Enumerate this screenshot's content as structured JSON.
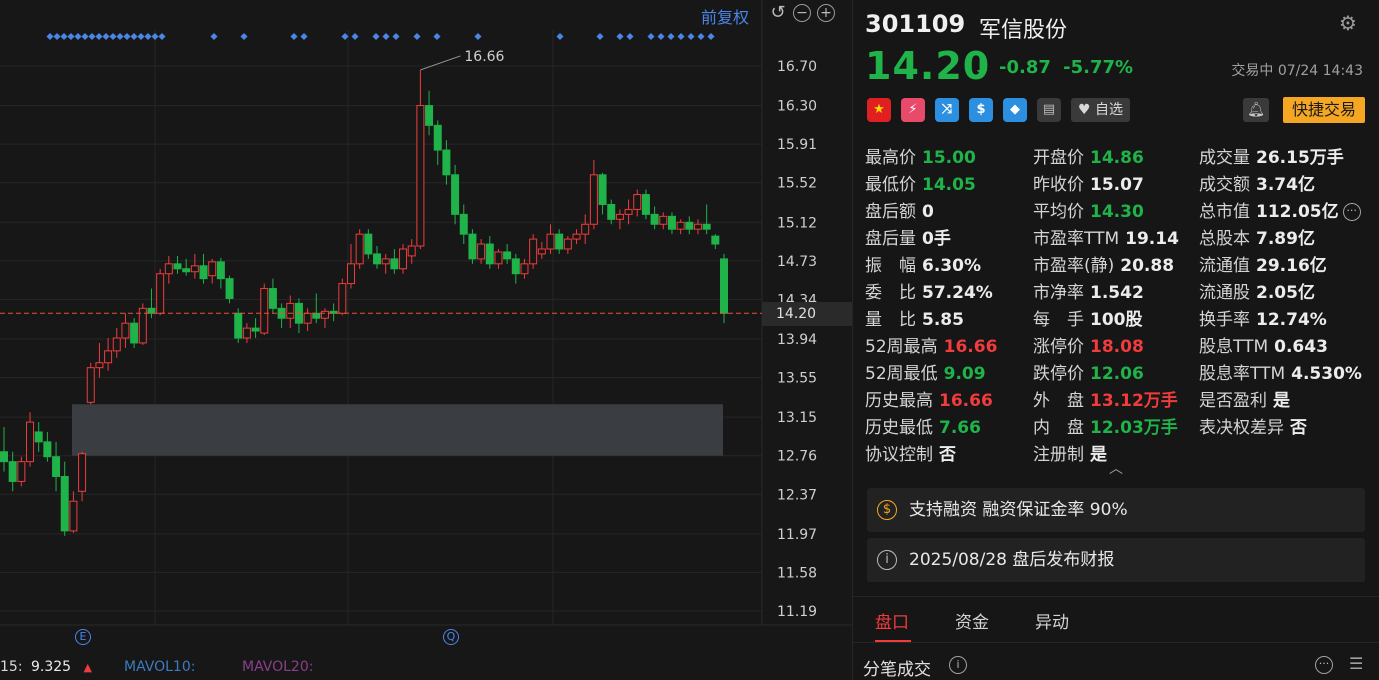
{
  "chart": {
    "adjust_label": "前复权",
    "undo_icon": "undo-icon",
    "minus_icon": "zoom-out-icon",
    "plus_icon": "zoom-in-icon",
    "high_label": "16.66",
    "price_tag": "14.20",
    "event_e": "E",
    "event_q": "Q",
    "mavol": {
      "ma5_label": "15:",
      "ma5_value": "9.325",
      "ma10_label": "MAVOL10:",
      "ma20_label": "MAVOL20:"
    },
    "colors": {
      "up": "#f03c3c",
      "down": "#1fb34a",
      "mavol10": "#3b7bbf",
      "mavol20": "#8a3f8a",
      "accent": "#4a86e8",
      "last_price_line": "#e8552e"
    }
  },
  "chart_data": {
    "type": "candlestick",
    "y_ticks": [
      "16.70",
      "16.30",
      "15.91",
      "15.52",
      "15.12",
      "14.73",
      "14.34",
      "13.94",
      "13.55",
      "13.15",
      "12.76",
      "12.37",
      "11.97",
      "11.58",
      "11.19"
    ],
    "ylim": [
      11.19,
      16.7
    ],
    "last_price": 14.2,
    "period_high": 16.66,
    "gap_zone": [
      12.76,
      13.28
    ],
    "candles": [
      [
        12.8,
        13.05,
        12.6,
        12.7
      ],
      [
        12.7,
        12.8,
        12.4,
        12.5
      ],
      [
        12.5,
        12.75,
        12.45,
        12.7
      ],
      [
        12.7,
        13.2,
        12.65,
        13.1
      ],
      [
        13.0,
        13.1,
        12.8,
        12.9
      ],
      [
        12.9,
        13.0,
        12.7,
        12.75
      ],
      [
        12.75,
        12.9,
        12.4,
        12.55
      ],
      [
        12.55,
        12.7,
        11.95,
        12.0
      ],
      [
        12.0,
        12.4,
        11.98,
        12.3
      ],
      [
        12.4,
        12.8,
        12.3,
        12.78
      ],
      [
        13.3,
        13.7,
        13.28,
        13.65
      ],
      [
        13.65,
        13.9,
        13.55,
        13.7
      ],
      [
        13.7,
        13.95,
        13.62,
        13.82
      ],
      [
        13.82,
        14.05,
        13.75,
        13.95
      ],
      [
        13.95,
        14.2,
        13.85,
        14.1
      ],
      [
        14.1,
        14.15,
        13.85,
        13.9
      ],
      [
        13.9,
        14.3,
        13.88,
        14.25
      ],
      [
        14.25,
        14.45,
        14.15,
        14.2
      ],
      [
        14.2,
        14.65,
        14.18,
        14.6
      ],
      [
        14.6,
        14.78,
        14.5,
        14.7
      ],
      [
        14.7,
        14.78,
        14.6,
        14.65
      ],
      [
        14.65,
        14.75,
        14.58,
        14.62
      ],
      [
        14.62,
        14.8,
        14.55,
        14.68
      ],
      [
        14.68,
        14.8,
        14.5,
        14.55
      ],
      [
        14.58,
        14.75,
        14.5,
        14.72
      ],
      [
        14.72,
        14.76,
        14.45,
        14.55
      ],
      [
        14.55,
        14.58,
        14.3,
        14.35
      ],
      [
        14.2,
        14.25,
        13.9,
        13.95
      ],
      [
        13.95,
        14.1,
        13.9,
        14.05
      ],
      [
        14.05,
        14.15,
        13.95,
        14.02
      ],
      [
        14.0,
        14.5,
        13.98,
        14.45
      ],
      [
        14.45,
        14.55,
        14.2,
        14.25
      ],
      [
        14.25,
        14.3,
        14.05,
        14.15
      ],
      [
        14.15,
        14.38,
        14.05,
        14.3
      ],
      [
        14.3,
        14.35,
        14.0,
        14.1
      ],
      [
        14.1,
        14.25,
        14.02,
        14.2
      ],
      [
        14.2,
        14.4,
        14.1,
        14.15
      ],
      [
        14.15,
        14.25,
        14.05,
        14.22
      ],
      [
        14.22,
        14.3,
        14.12,
        14.2
      ],
      [
        14.2,
        14.55,
        14.18,
        14.5
      ],
      [
        14.5,
        14.9,
        14.45,
        14.7
      ],
      [
        14.7,
        15.05,
        14.65,
        15.0
      ],
      [
        15.0,
        15.05,
        14.75,
        14.8
      ],
      [
        14.8,
        14.88,
        14.65,
        14.7
      ],
      [
        14.7,
        14.8,
        14.6,
        14.75
      ],
      [
        14.75,
        14.85,
        14.6,
        14.65
      ],
      [
        14.65,
        14.9,
        14.6,
        14.85
      ],
      [
        14.78,
        14.95,
        14.7,
        14.88
      ],
      [
        14.88,
        16.66,
        14.85,
        16.3
      ],
      [
        16.3,
        16.45,
        16.0,
        16.1
      ],
      [
        16.1,
        16.15,
        15.7,
        15.85
      ],
      [
        15.85,
        15.95,
        15.5,
        15.6
      ],
      [
        15.6,
        15.7,
        15.1,
        15.2
      ],
      [
        15.2,
        15.3,
        14.9,
        15.0
      ],
      [
        15.0,
        15.05,
        14.7,
        14.75
      ],
      [
        14.75,
        14.95,
        14.7,
        14.9
      ],
      [
        14.9,
        14.98,
        14.65,
        14.7
      ],
      [
        14.7,
        14.85,
        14.65,
        14.82
      ],
      [
        14.82,
        14.9,
        14.7,
        14.75
      ],
      [
        14.75,
        14.8,
        14.5,
        14.6
      ],
      [
        14.6,
        14.75,
        14.55,
        14.7
      ],
      [
        14.7,
        15.0,
        14.65,
        14.95
      ],
      [
        14.8,
        14.92,
        14.75,
        14.85
      ],
      [
        14.85,
        15.1,
        14.8,
        15.0
      ],
      [
        15.0,
        15.05,
        14.8,
        14.85
      ],
      [
        14.85,
        14.98,
        14.8,
        14.95
      ],
      [
        14.95,
        15.05,
        14.9,
        15.0
      ],
      [
        15.0,
        15.2,
        14.9,
        15.1
      ],
      [
        15.1,
        15.75,
        15.05,
        15.6
      ],
      [
        15.6,
        15.62,
        15.2,
        15.3
      ],
      [
        15.3,
        15.35,
        15.1,
        15.15
      ],
      [
        15.15,
        15.25,
        15.05,
        15.2
      ],
      [
        15.2,
        15.35,
        15.1,
        15.25
      ],
      [
        15.25,
        15.45,
        15.18,
        15.4
      ],
      [
        15.4,
        15.45,
        15.15,
        15.2
      ],
      [
        15.2,
        15.28,
        15.05,
        15.1
      ],
      [
        15.1,
        15.22,
        15.05,
        15.18
      ],
      [
        15.18,
        15.22,
        15.0,
        15.05
      ],
      [
        15.05,
        15.15,
        15.0,
        15.12
      ],
      [
        15.12,
        15.18,
        15.0,
        15.05
      ],
      [
        15.05,
        15.15,
        15.0,
        15.1
      ],
      [
        15.1,
        15.3,
        15.0,
        15.05
      ],
      [
        14.98,
        15.0,
        14.85,
        14.9
      ],
      [
        14.75,
        14.8,
        14.1,
        14.2
      ]
    ]
  },
  "quote": {
    "code": "301109",
    "name": "军信股份",
    "price": "14.20",
    "change": "-0.87",
    "change_pct": "-5.77%",
    "status": "交易中 07/24 14:43",
    "fav_label": "自选",
    "quick_trade": "快捷交易"
  },
  "stats": {
    "col1": [
      {
        "k": "最高价",
        "v": "15.00",
        "c": "g"
      },
      {
        "k": "最低价",
        "v": "14.05",
        "c": "g"
      },
      {
        "k": "盘后额",
        "v": "0",
        "c": "w"
      },
      {
        "k": "盘后量",
        "v": "0手",
        "c": "w"
      },
      {
        "k": "振　幅",
        "v": "6.30%",
        "c": "w"
      },
      {
        "k": "委　比",
        "v": "57.24%",
        "c": "w"
      },
      {
        "k": "量　比",
        "v": "5.85",
        "c": "w"
      },
      {
        "k": "52周最高",
        "v": "16.66",
        "c": "r"
      },
      {
        "k": "52周最低",
        "v": "9.09",
        "c": "g"
      },
      {
        "k": "历史最高",
        "v": "16.66",
        "c": "r"
      },
      {
        "k": "历史最低",
        "v": "7.66",
        "c": "g"
      },
      {
        "k": "协议控制",
        "v": "否",
        "c": "w"
      }
    ],
    "col2": [
      {
        "k": "开盘价",
        "v": "14.86",
        "c": "g"
      },
      {
        "k": "昨收价",
        "v": "15.07",
        "c": "w"
      },
      {
        "k": "平均价",
        "v": "14.30",
        "c": "g"
      },
      {
        "k": "市盈率TTM",
        "v": "19.14",
        "c": "w"
      },
      {
        "k": "市盈率(静)",
        "v": "20.88",
        "c": "w"
      },
      {
        "k": "市净率",
        "v": "1.542",
        "c": "w"
      },
      {
        "k": "每　手",
        "v": "100股",
        "c": "w"
      },
      {
        "k": "涨停价",
        "v": "18.08",
        "c": "r"
      },
      {
        "k": "跌停价",
        "v": "12.06",
        "c": "g"
      },
      {
        "k": "外　盘",
        "v": "13.12万手",
        "c": "r"
      },
      {
        "k": "内　盘",
        "v": "12.03万手",
        "c": "g"
      },
      {
        "k": "注册制",
        "v": "是",
        "c": "w"
      }
    ],
    "col3": [
      {
        "k": "成交量",
        "v": "26.15万手",
        "c": "w"
      },
      {
        "k": "成交额",
        "v": "3.74亿",
        "c": "w"
      },
      {
        "k": "总市值",
        "v": "112.05亿",
        "c": "w"
      },
      {
        "k": "总股本",
        "v": "7.89亿",
        "c": "w"
      },
      {
        "k": "流通值",
        "v": "29.16亿",
        "c": "w"
      },
      {
        "k": "流通股",
        "v": "2.05亿",
        "c": "w"
      },
      {
        "k": "换手率",
        "v": "12.74%",
        "c": "w"
      },
      {
        "k": "股息TTM",
        "v": "0.643",
        "c": "w"
      },
      {
        "k": "股息率TTM",
        "v": "4.530%",
        "c": "w"
      },
      {
        "k": "是否盈利",
        "v": "是",
        "c": "w"
      },
      {
        "k": "表决权差异",
        "v": "否",
        "c": "w"
      }
    ]
  },
  "notices": {
    "margin": "支持融资 融资保证金率 90%",
    "report": "2025/08/28  盘后发布财报"
  },
  "tabs": [
    "盘口",
    "资金",
    "异动"
  ],
  "tick": {
    "title": "分笔成交"
  }
}
